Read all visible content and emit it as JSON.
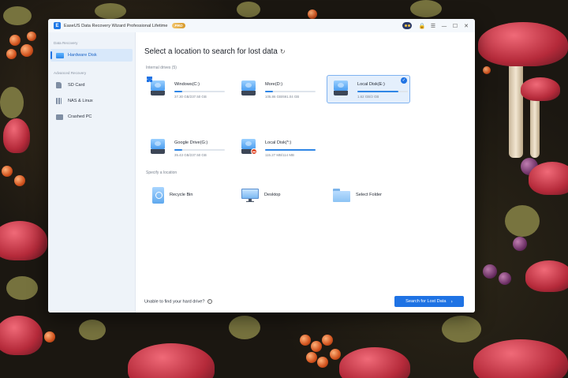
{
  "window": {
    "title": "EaseUS Data Recovery Wizard Professional Lifetime",
    "badge": "PRO",
    "controls": {
      "lock": "🔒",
      "menu": "☰",
      "minimize": "—",
      "maximize": "☐",
      "close": "✕"
    }
  },
  "sidebar": {
    "section_recovery": "Data Recovery",
    "section_advanced": "Advanced Recovery",
    "items": [
      {
        "label": "Hardware Disk",
        "icon": "hardware-disk-icon",
        "active": true
      },
      {
        "label": "SD Card",
        "icon": "sd-card-icon"
      },
      {
        "label": "NAS & Linux",
        "icon": "nas-icon"
      },
      {
        "label": "Crashed PC",
        "icon": "crashed-pc-icon"
      }
    ]
  },
  "main": {
    "heading": "Select a location to search for lost data",
    "internal_drives_label": "Internal drives (5)",
    "drives": [
      {
        "name": "Windows(C:)",
        "size": "37.30 GB/237.50 GB",
        "fill": 0.16,
        "badge": "windows"
      },
      {
        "name": "More(D:)",
        "size": "105.86 GB/691.04 GB",
        "fill": 0.15
      },
      {
        "name": "Local Disk(E:)",
        "size": "1.62 GB/2 GB",
        "fill": 0.81,
        "selected": true
      },
      {
        "name": "Google Drive(G:)",
        "size": "35.43 GB/237.50 GB",
        "fill": 0.15
      },
      {
        "name": "Local Disk(*:)",
        "size": "115.27 MB/114 MB",
        "fill": 1.0,
        "badge": "warning"
      }
    ],
    "specify_label": "Specify a location",
    "locations": [
      {
        "label": "Recycle Bin",
        "icon": "recycle-bin-icon"
      },
      {
        "label": "Desktop",
        "icon": "desktop-icon"
      },
      {
        "label": "Select Folder",
        "icon": "folder-icon"
      }
    ],
    "footer_text": "Unable to find your hard drive?",
    "search_button": "Search for Lost Data",
    "colors": {
      "accent": "#1f73e4",
      "selected_bg": "#e4effc"
    }
  }
}
